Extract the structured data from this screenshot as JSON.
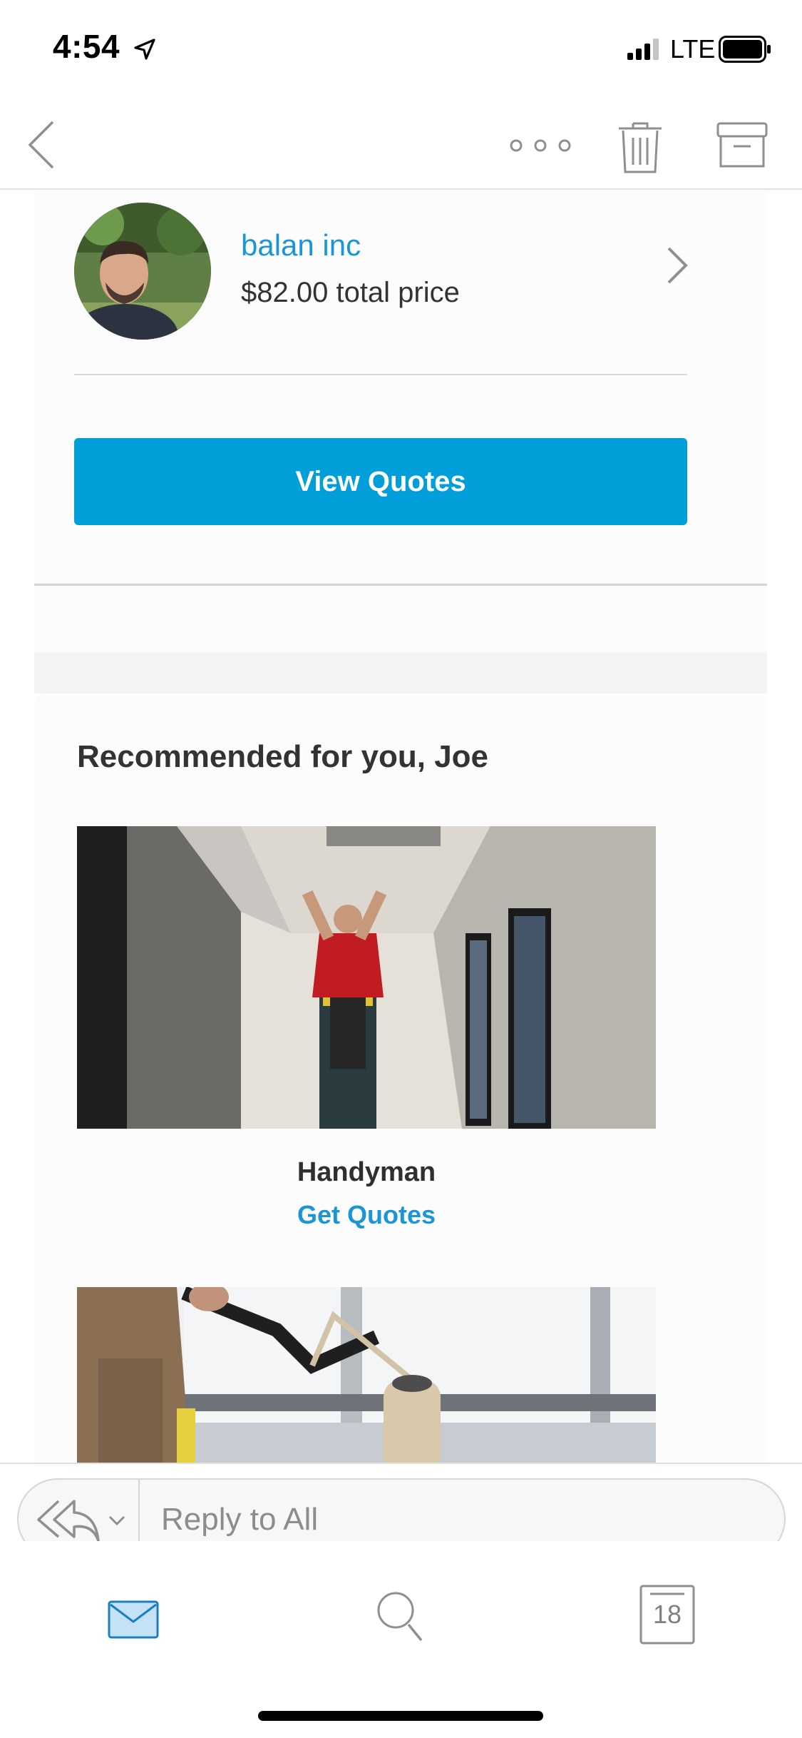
{
  "status_bar": {
    "time": "4:54",
    "network": "LTE"
  },
  "toolbar": {
    "back_icon": "chevron-left-icon",
    "more_icon": "more-horizontal-icon",
    "delete_icon": "trash-icon",
    "archive_icon": "archive-icon"
  },
  "quote": {
    "pro_name": "balan inc",
    "price_text": "$82.00 total price",
    "view_button_label": "View Quotes"
  },
  "recommendations": {
    "heading": "Recommended for you, Joe",
    "items": [
      {
        "title": "Handyman",
        "link_label": "Get Quotes"
      }
    ]
  },
  "reply": {
    "placeholder": "Reply to All",
    "action_icon": "reply-all-icon"
  },
  "tab_bar": {
    "mail_icon": "mail-icon",
    "search_icon": "search-icon",
    "calendar_icon": "calendar-icon",
    "calendar_day": "18"
  },
  "colors": {
    "accent": "#009fd9",
    "link": "#1a96d4",
    "text": "#333333"
  }
}
